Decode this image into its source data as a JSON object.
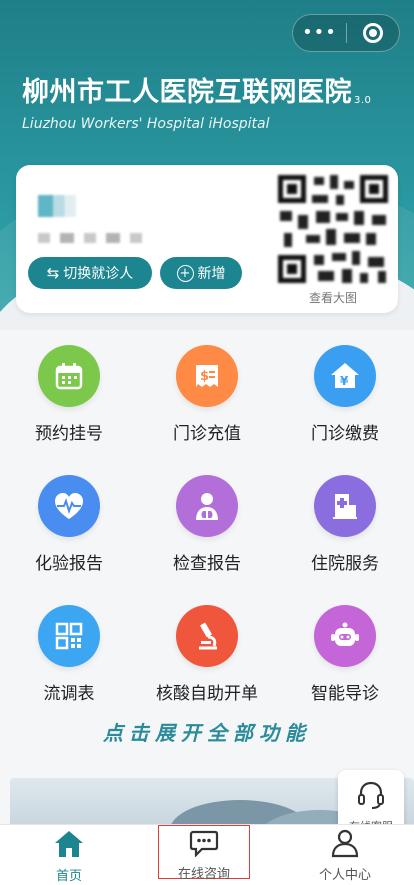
{
  "header": {
    "title_cn": "柳州市工人医院互联网医院",
    "version": "3.0",
    "title_en": "Liuzhou Workers' Hospital iHospital"
  },
  "capsule": {
    "more_icon": "more-dots-icon",
    "close_icon": "target-icon"
  },
  "patient_card": {
    "switch_label": "切换就诊人",
    "add_label": "新增",
    "qr_label": "查看大图"
  },
  "services": [
    {
      "label": "预约挂号",
      "icon": "calendar-icon",
      "color": "#7cc84a"
    },
    {
      "label": "门诊充值",
      "icon": "receipt-dollar-icon",
      "color": "#ff8a45"
    },
    {
      "label": "门诊缴费",
      "icon": "house-yen-icon",
      "color": "#3a9ff0"
    },
    {
      "label": "化验报告",
      "icon": "heart-pulse-icon",
      "color": "#4a8df0"
    },
    {
      "label": "检查报告",
      "icon": "doctor-lungs-icon",
      "color": "#b26fd9"
    },
    {
      "label": "住院服务",
      "icon": "hospital-bed-icon",
      "color": "#8a6ee0"
    },
    {
      "label": "流调表",
      "icon": "qr-grid-icon",
      "color": "#3ca6f2"
    },
    {
      "label": "核酸自助开单",
      "icon": "microscope-icon",
      "color": "#f0563c"
    },
    {
      "label": "智能导诊",
      "icon": "robot-icon",
      "color": "#c465d8"
    }
  ],
  "expand_all": "点击展开全部功能",
  "online_service": {
    "label": "在线客服",
    "icon": "headset-icon"
  },
  "tabbar": {
    "home": "首页",
    "consult": "在线咨询",
    "me": "个人中心",
    "active_color": "#1d8590"
  }
}
